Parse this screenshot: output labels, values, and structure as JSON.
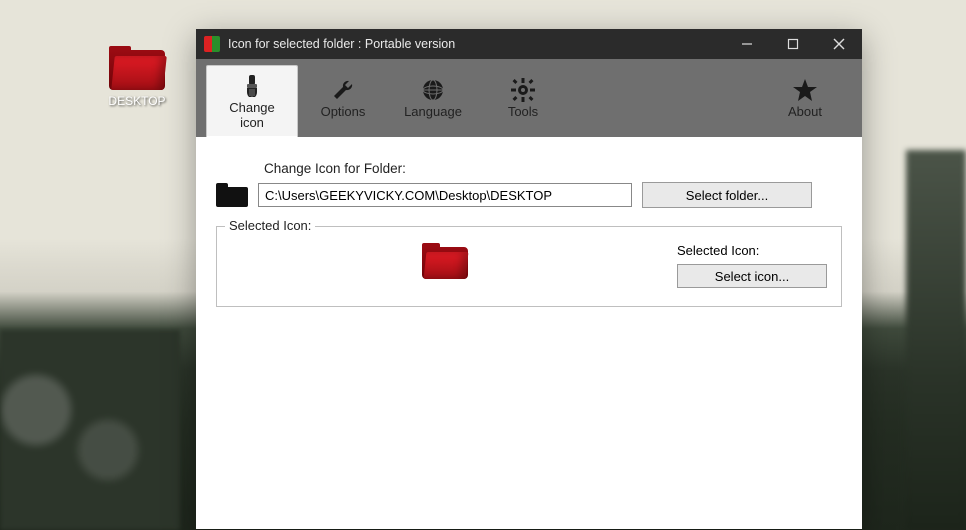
{
  "desktop": {
    "icon_label": "DESKTOP"
  },
  "window": {
    "title": "Icon for selected folder : Portable version"
  },
  "toolbar": {
    "change_line1": "Change",
    "change_line2": "icon",
    "options": "Options",
    "language": "Language",
    "tools": "Tools",
    "about": "About"
  },
  "main": {
    "change_label": "Change Icon for Folder:",
    "path_value": "C:\\Users\\GEEKYVICKY.COM\\Desktop\\DESKTOP",
    "select_folder": "Select folder...",
    "group_title": "Selected Icon:",
    "inner_label": "Selected Icon:",
    "select_icon": "Select icon..."
  }
}
